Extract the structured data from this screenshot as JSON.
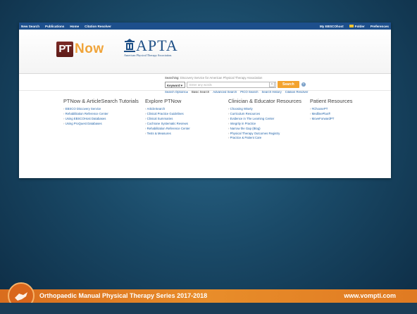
{
  "topbar": {
    "left": [
      "New Search",
      "Publications",
      "Home",
      "Citation Resolver"
    ],
    "right": [
      "My EBSCOhost",
      "Folder",
      "Preferences"
    ]
  },
  "logos": {
    "pt": "PT",
    "now": "Now",
    "apta_name": "APTA",
    "apta_sub": "American Physical Therapy Association."
  },
  "search": {
    "searching_label": "Searching:",
    "searching_value": "Discovery Service for American Physical Therapy Association",
    "field_select": "Keyword",
    "placeholder": "Enter any words",
    "clear": "×",
    "button": "Search",
    "help": "?",
    "links": [
      "Search Options ▸",
      "Basic Search",
      "Advanced Search",
      "PICO Search",
      "Search History",
      "Citation Resolver"
    ]
  },
  "columns": [
    {
      "heading": "PTNow & ArticleSearch Tutorials",
      "items": [
        "EBSCO Discovery Service",
        "Rehabilitation Reference Center",
        "Using EBSCOHost Databases",
        "Using ProQuest Databases"
      ]
    },
    {
      "heading": "Explore PTNow",
      "items": [
        "ArticleSearch",
        "Clinical Practice Guidelines",
        "Clinical Summaries",
        "Cochrane Systematic Reviews",
        "Rehabilitation Reference Center",
        "Tests & Measures"
      ]
    },
    {
      "heading": "Clinician & Educator Resources",
      "items": [
        "Choosing Wisely",
        "Curriculum Resources",
        "Evidence in The Learning Center",
        "Integrity in Practice",
        "Narrow the Gap (Blog)",
        "Physical Therapy Outcomes Registry",
        "Practice & Patient Care"
      ]
    },
    {
      "heading": "Patient Resources",
      "items": [
        "#ChoosePT",
        "MedlinePlus®",
        "MoveForwardPT"
      ]
    }
  ],
  "footer": {
    "title": "Orthopaedic Manual Physical Therapy Series 2017-2018",
    "url": "www.vompti.com"
  },
  "colors": {
    "accent": "#f3a32e",
    "topbar": "#1d4f8c",
    "footer": "#e88d2a"
  }
}
